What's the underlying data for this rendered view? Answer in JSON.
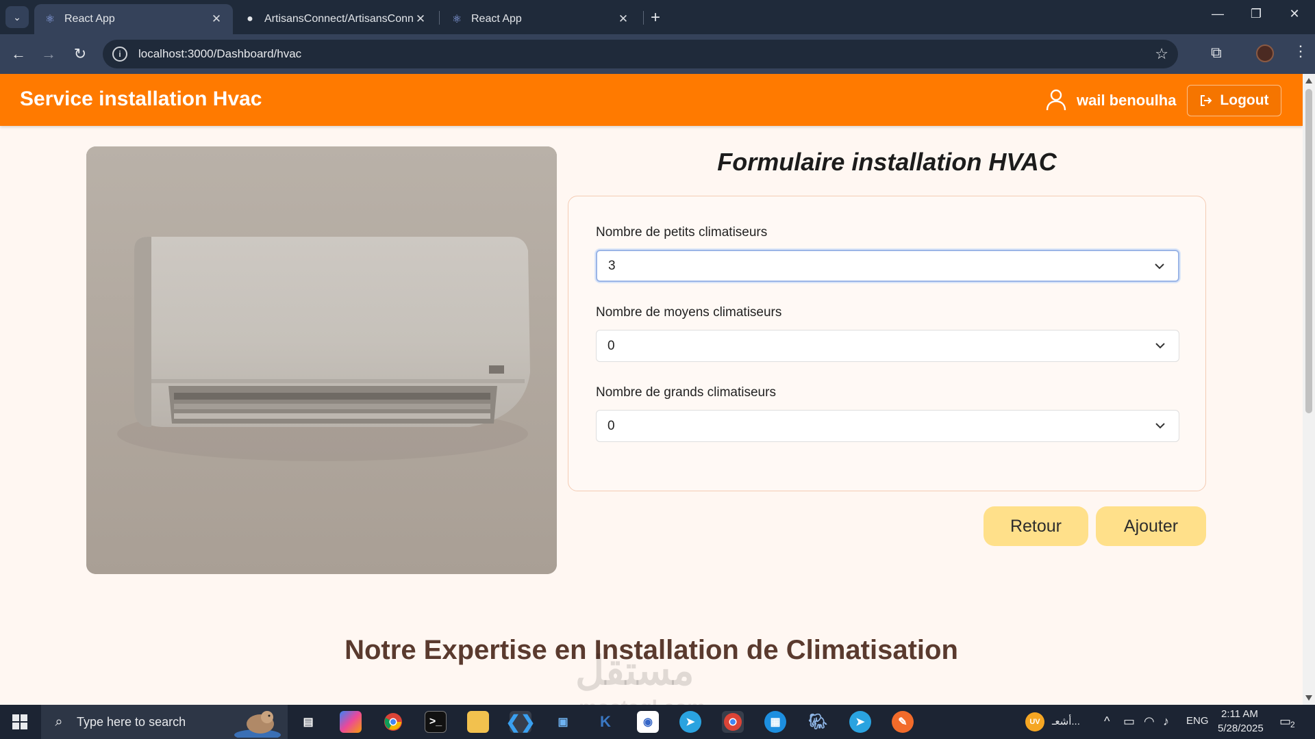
{
  "browser": {
    "tab_list_icon": "chevron-down-icon",
    "tabs": [
      {
        "title": "React App",
        "active": true,
        "favicon": "react-icon"
      },
      {
        "title": "ArtisansConnect/ArtisansConne",
        "active": false,
        "favicon": "github-icon"
      },
      {
        "title": "React App",
        "active": false,
        "favicon": "react-icon"
      }
    ],
    "url": "localhost:3000/Dashboard/hvac"
  },
  "app": {
    "brand": "Service installation Hvac",
    "username": "wail benoulha",
    "logout_label": "Logout",
    "accent_color": "#ff7a00"
  },
  "form": {
    "title": "Formulaire installation HVAC",
    "fields": [
      {
        "label": "Nombre de petits climatiseurs",
        "value": "3"
      },
      {
        "label": "Nombre de moyens climatiseurs",
        "value": "0"
      },
      {
        "label": "Nombre de grands climatiseurs",
        "value": "0"
      }
    ],
    "back_label": "Retour",
    "submit_label": "Ajouter",
    "button_color": "#ffe08a"
  },
  "section": {
    "heading": "Notre Expertise en Installation de Climatisation"
  },
  "watermark": {
    "text_ar": "مستقل",
    "text_en": "mostaql.com"
  },
  "taskbar": {
    "search_placeholder": "Type here to search",
    "weather_text": "أشعـ...",
    "uv_badge": "UV",
    "language": "ENG",
    "time": "2:11 AM",
    "date": "5/28/2025",
    "notification_count": "2"
  }
}
